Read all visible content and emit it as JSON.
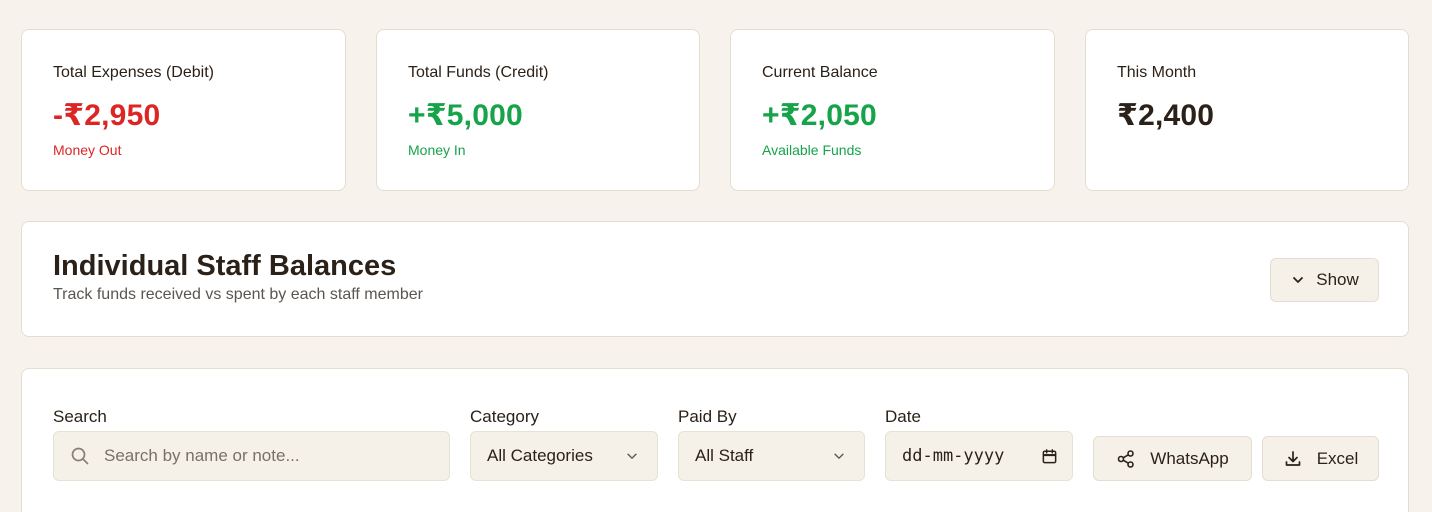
{
  "stats": [
    {
      "label": "Total Expenses (Debit)",
      "value": "-₹2,950",
      "sub": "Money Out",
      "color": "#dc2626"
    },
    {
      "label": "Total Funds (Credit)",
      "value": "+₹5,000",
      "sub": "Money In",
      "color": "#16a34a"
    },
    {
      "label": "Current Balance",
      "value": "+₹2,050",
      "sub": "Available Funds",
      "color": "#16a34a"
    },
    {
      "label": "This Month",
      "value": "₹2,400",
      "sub": "",
      "color": "#2b2118"
    }
  ],
  "staff": {
    "title": "Individual Staff Balances",
    "subtitle": "Track funds received vs spent by each staff member",
    "show_label": "Show"
  },
  "filters": {
    "search_label": "Search",
    "search_placeholder": "Search by name or note...",
    "search_value": "",
    "category_label": "Category",
    "category_value": "All Categories",
    "paid_by_label": "Paid By",
    "paid_by_value": "All Staff",
    "date_label": "Date",
    "date_value": "dd-mm-yyyy",
    "whatsapp_label": "WhatsApp",
    "excel_label": "Excel"
  },
  "icons": {
    "search": "search-icon",
    "chevron": "chevron-down-icon",
    "calendar": "calendar-icon",
    "share": "share-icon",
    "download": "download-icon"
  }
}
